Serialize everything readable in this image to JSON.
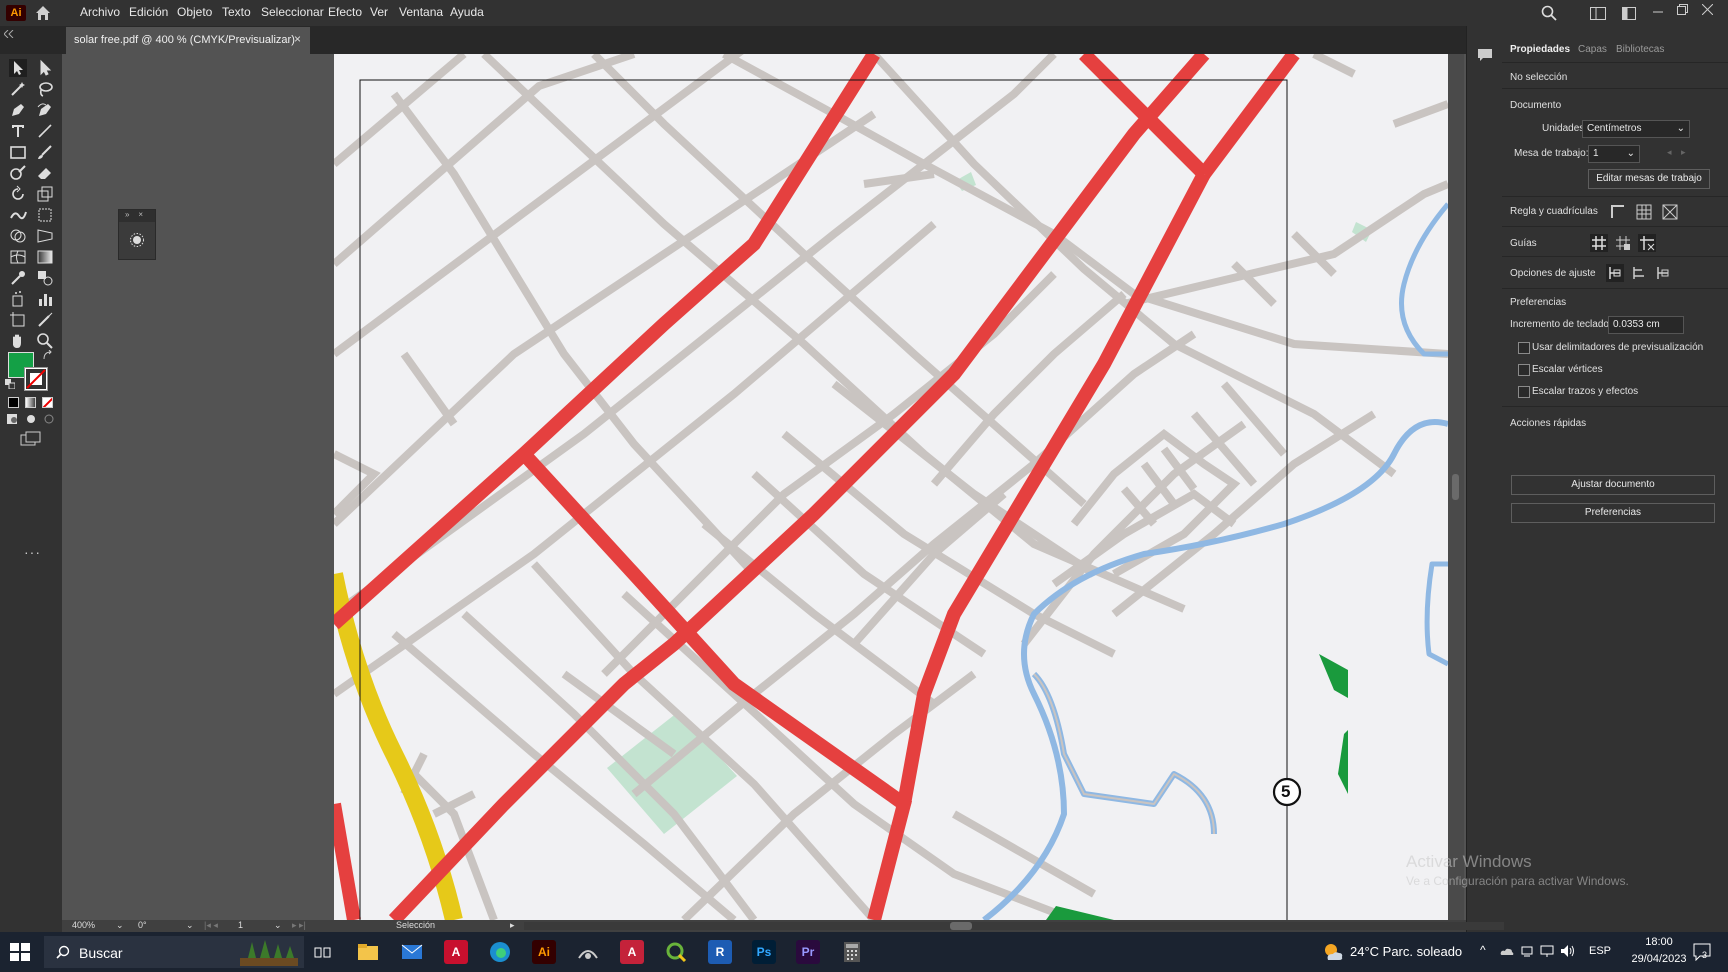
{
  "app": {
    "logo_text": "Ai",
    "accent": "#ff9a00"
  },
  "menus": [
    "Archivo",
    "Edición",
    "Objeto",
    "Texto",
    "Seleccionar",
    "Efecto",
    "Ver",
    "Ventana",
    "Ayuda"
  ],
  "document_tab": {
    "title": "solar free.pdf @ 400 % (CMYK/Previsualizar)",
    "close": "×"
  },
  "properties_panel": {
    "tabs": [
      "Propiedades",
      "Capas",
      "Bibliotecas"
    ],
    "selection_status": "No selección",
    "document_section": "Documento",
    "units_label": "Unidades:",
    "units_value": "Centímetros",
    "artboard_label": "Mesa de trabajo:",
    "artboard_value": "1",
    "edit_artboards_button": "Editar mesas de trabajo",
    "rulers_grids_label": "Regla y cuadrículas",
    "guides_label": "Guías",
    "snap_options_label": "Opciones de ajuste",
    "preferences_section": "Preferencias",
    "keyboard_increment_label": "Incremento de teclado:",
    "keyboard_increment_value": "0.0353 cm",
    "checkboxes": [
      "Usar delimitadores de previsualización",
      "Escalar vértices",
      "Escalar trazos y efectos"
    ],
    "quick_actions_label": "Acciones rápidas",
    "fit_document_button": "Ajustar documento",
    "preferences_button": "Preferencias"
  },
  "status_bar": {
    "zoom": "400%",
    "rotation": "0°",
    "artboard_number": "1",
    "tool": "Selección"
  },
  "canvas": {
    "marker_label": "5"
  },
  "watermark": {
    "line1": "Activar Windows",
    "line2": "Ve a Configuración para activar Windows."
  },
  "taskbar": {
    "search_placeholder": "Buscar",
    "weather": "24°C  Parc. soleado",
    "language": "ESP",
    "time": "18:00",
    "date": "29/04/2023",
    "notifications": "3"
  },
  "colors": {
    "road_main": "#e5403f",
    "road_secondary": "#c9c4c1",
    "river": "#8fb8e3",
    "park": "#c3e3d0",
    "yellow_road": "#e6c919",
    "green_area": "#1a9a3d",
    "fill_swatch": "#14a046"
  }
}
